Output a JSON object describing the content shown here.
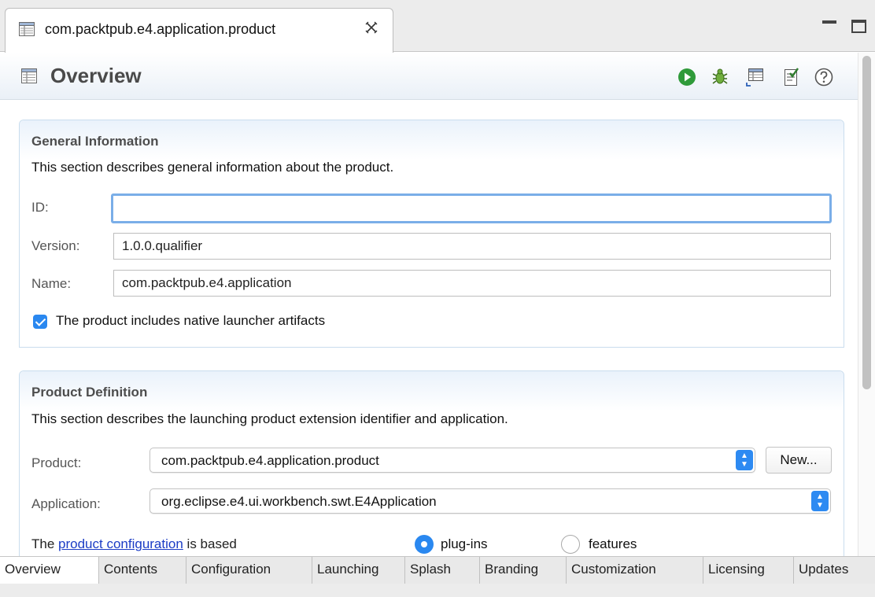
{
  "editor_tab": {
    "title": "com.packtpub.e4.application.product"
  },
  "header": {
    "title": "Overview",
    "toolbar": [
      "run-icon",
      "debug-icon",
      "export-icon",
      "validate-icon",
      "help-icon"
    ]
  },
  "general": {
    "title": "General Information",
    "description": "This section describes general information about the product.",
    "id_label": "ID:",
    "id_value": "",
    "version_label": "Version:",
    "version_value": "1.0.0.qualifier",
    "name_label": "Name:",
    "name_value": "com.packtpub.e4.application",
    "launcher_checkbox_label": "The product includes native launcher artifacts",
    "launcher_checked": true
  },
  "product_def": {
    "title": "Product Definition",
    "description": "This section describes the launching product extension identifier and application.",
    "product_label": "Product:",
    "product_value": "com.packtpub.e4.application.product",
    "new_button": "New...",
    "application_label": "Application:",
    "application_value": "org.eclipse.e4.ui.workbench.swt.E4Application",
    "config_prefix": "The",
    "config_link": "product configuration",
    "config_suffix": "is based",
    "radio_plugins": "plug-ins",
    "radio_features": "features",
    "selected_radio": "plug-ins"
  },
  "page_tabs": [
    "Overview",
    "Contents",
    "Configuration",
    "Launching",
    "Splash",
    "Branding",
    "Customization",
    "Licensing",
    "Updates"
  ],
  "active_page_tab": "Overview",
  "colors": {
    "accent": "#2a88f0",
    "link": "#1b3cc5",
    "section_border": "#c9ddee"
  }
}
